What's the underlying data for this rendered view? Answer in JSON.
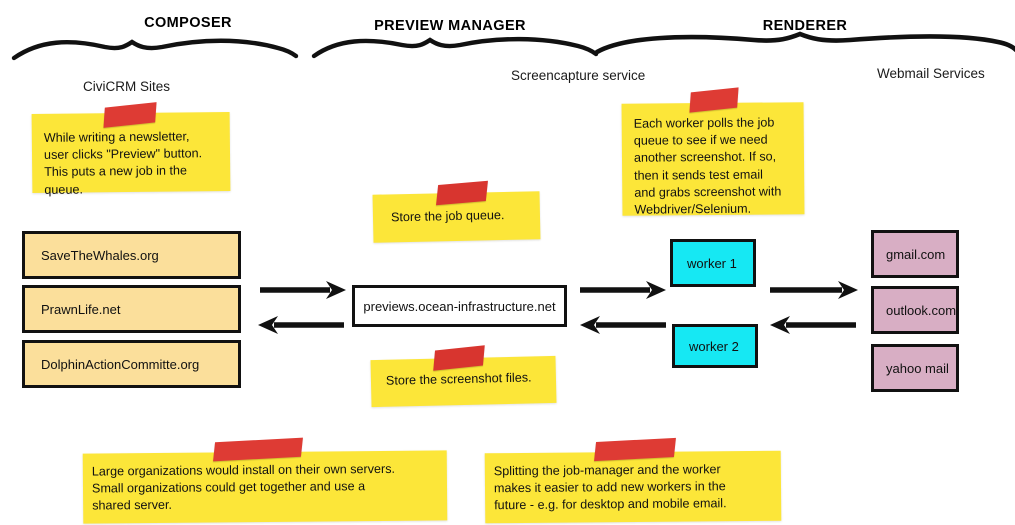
{
  "diagram": {
    "title": "Preview/screenshot architecture whiteboard diagram",
    "sections": [
      {
        "id": "composer",
        "label": "COMPOSER"
      },
      {
        "id": "preview-manager",
        "label": "PREVIEW MANAGER"
      },
      {
        "id": "renderer",
        "label": "RENDERER"
      }
    ],
    "sub_labels": [
      {
        "id": "civicrm-sites",
        "label": "CiviCRM Sites"
      },
      {
        "id": "screencapture-service",
        "label": "Screencapture service"
      },
      {
        "id": "webmail-services",
        "label": "Webmail Services"
      }
    ],
    "sticky_notes": [
      {
        "id": "composer-note",
        "text": "While writing a newsletter,\nuser clicks \"Preview\" button.\nThis puts a new job in the\nqueue."
      },
      {
        "id": "job-queue-note",
        "text": "Store the job queue."
      },
      {
        "id": "worker-note",
        "text": "Each worker polls the job\nqueue to see if we need\nanother screenshot. If so,\nthen it sends test email\nand grabs screenshot with\nWebdriver/Selenium."
      },
      {
        "id": "screenshot-files-note",
        "text": "Store the screenshot files."
      },
      {
        "id": "hosting-note",
        "text": "Large organizations would install on their own servers.\nSmall organizations could get together and use a\nshared server."
      },
      {
        "id": "splitting-note",
        "text": "Splitting the job-manager and the worker\nmakes it easier to add new workers in the\nfuture - e.g. for desktop and mobile email."
      }
    ],
    "sites": [
      {
        "id": "site-savethewhales",
        "label": "SaveTheWhales.org"
      },
      {
        "id": "site-prawnlife",
        "label": "PrawnLife.net"
      },
      {
        "id": "site-dolphinaction",
        "label": "DolphinActionCommitte.org"
      }
    ],
    "server": {
      "id": "preview-server",
      "label": "previews.ocean-infrastructure.net"
    },
    "workers": [
      {
        "id": "worker-1",
        "label": "worker 1"
      },
      {
        "id": "worker-2",
        "label": "worker 2"
      }
    ],
    "webmail": [
      {
        "id": "webmail-gmail",
        "label": "gmail.com"
      },
      {
        "id": "webmail-outlook",
        "label": "outlook.com"
      },
      {
        "id": "webmail-yahoo",
        "label": "yahoo mail"
      }
    ],
    "colors": {
      "sticky_yellow": "#FCE639",
      "tape_red": "#DE3B34",
      "site_box": "#FBDF9B",
      "worker_box": "#16E8F3",
      "webmail_box": "#D8AEC4",
      "stroke": "#111111"
    }
  }
}
